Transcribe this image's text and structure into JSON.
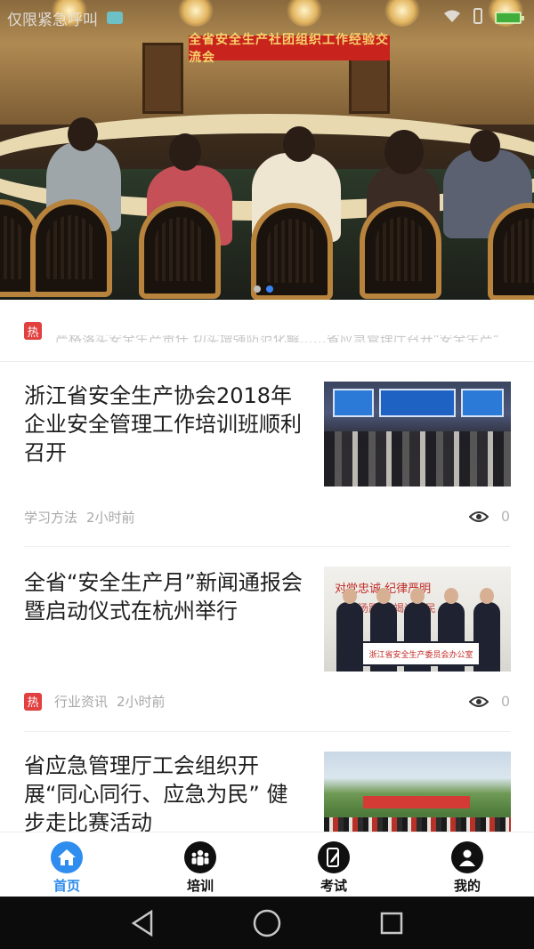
{
  "status_bar": {
    "carrier": "仅限紧急呼叫"
  },
  "banner": {
    "sign_text": "全省安全生产社团组织工作经验交流会",
    "slide_count": 2,
    "active_slide": 2
  },
  "ticker": {
    "badge": "热",
    "text": "严格落实安全生产责任 切实增强防范化解……省应急管理厅召开\"安全生产\"工作会"
  },
  "news": [
    {
      "title": "浙江省安全生产协会2018年企业安全管理工作培训班顺利召开",
      "hot": false,
      "category": "学习方法",
      "time": "2小时前",
      "views": "0"
    },
    {
      "title": "全省“安全生产月”新闻通报会暨启动仪式在杭州举行",
      "hot": true,
      "badge": "热",
      "category": "行业资讯",
      "time": "2小时前",
      "views": "0",
      "thumb_slogan": "对党忠诚  纪律严明",
      "thumb_slogan2": "赴汤蹈火  竭诚为民",
      "thumb_plaque": "浙江省安全生产委员会办公室"
    },
    {
      "title": "省应急管理厅工会组织开展“同心同行、应急为民” 健步走比赛活动",
      "hot": false
    }
  ],
  "bottom_nav": [
    {
      "label": "首页",
      "icon": "home-icon",
      "active": true
    },
    {
      "label": "培训",
      "icon": "group-icon",
      "active": false
    },
    {
      "label": "考试",
      "icon": "exam-phone-icon",
      "active": false
    },
    {
      "label": "我的",
      "icon": "user-icon",
      "active": false
    }
  ],
  "colors": {
    "accent": "#2f8df0",
    "hot": "#e23f3f",
    "title_text": "#1e1e1e",
    "meta_text": "#a8a8a8"
  }
}
